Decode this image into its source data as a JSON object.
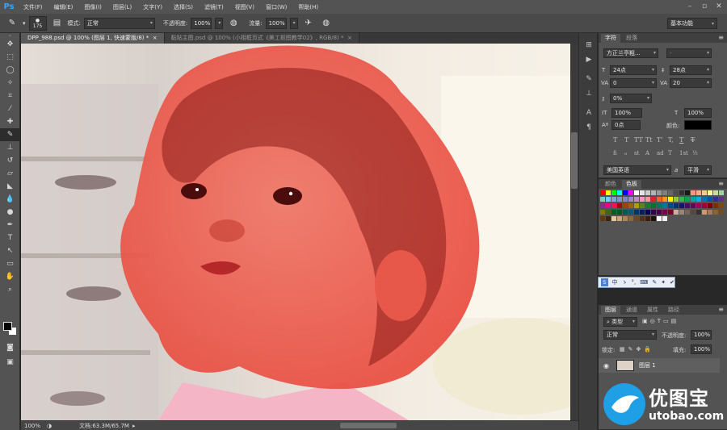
{
  "app": {
    "logo": "Ps"
  },
  "menu": [
    "文件(F)",
    "编辑(E)",
    "图像(I)",
    "图层(L)",
    "文字(Y)",
    "选择(S)",
    "滤镜(T)",
    "视图(V)",
    "窗口(W)",
    "帮助(H)"
  ],
  "options": {
    "brush_size": "175",
    "mode_label": "模式:",
    "mode_value": "正常",
    "opacity_label": "不透明度:",
    "opacity_value": "100%",
    "flow_label": "流量:",
    "flow_value": "100%",
    "workspace": "基本功能"
  },
  "tabs": [
    {
      "label": "DPP_988.psd @ 100% (图层 1, 快速蒙版/8) *",
      "active": true
    },
    {
      "label": "黏贴主图.psd @ 100% (小相框页式《美工抠图教学02》, RGB/8) *",
      "active": false
    }
  ],
  "status": {
    "zoom": "100%",
    "doc": "文档:63.3M/65.7M"
  },
  "character": {
    "tabs": [
      "字符",
      "段落"
    ],
    "font_family": "方正兰亭粗...",
    "font_style": "-",
    "font_size": "24点",
    "leading": "28点",
    "kerning": "0",
    "tracking": "20",
    "scale_pct": "0%",
    "vscale": "100%",
    "hscale": "100%",
    "baseline": "0点",
    "color_label": "颜色:",
    "styles": [
      "T",
      "T",
      "TT",
      "Tt",
      "T'",
      "T,",
      "T",
      "T"
    ],
    "opentype": [
      "fi",
      "ℴ",
      "st",
      "A",
      "ad",
      "T",
      "1st",
      "½"
    ],
    "language": "美国英语",
    "aa_label": "a",
    "antialias": "平滑"
  },
  "swatches": {
    "tabs": [
      "颜色",
      "色板"
    ],
    "rows": [
      [
        "#ff0000",
        "#ffff00",
        "#00ff00",
        "#00ffff",
        "#0000ff",
        "#ff00ff",
        "#ffffff",
        "#e6e6e6",
        "#cccccc",
        "#b3b3b3",
        "#999999",
        "#808080",
        "#666666",
        "#4d4d4d",
        "#333333",
        "#1a1a1a",
        "#f7977a",
        "#f9ad81",
        "#fdc68a",
        "#fff79a",
        "#c4df9b",
        "#a3d39c"
      ],
      [
        "#7accc8",
        "#6dcff6",
        "#7ea7d8",
        "#8493ca",
        "#8882be",
        "#a187be",
        "#bc8dbf",
        "#f49ac2",
        "#f6989d",
        "#ed1c24",
        "#f26522",
        "#f7941d",
        "#fff200",
        "#8dc63f",
        "#39b54a",
        "#00a651",
        "#00a99d",
        "#00aeef",
        "#0072bc",
        "#0054a6",
        "#2e3192",
        "#662d91"
      ],
      [
        "#92278f",
        "#ec008c",
        "#ed145b",
        "#9e0b0f",
        "#a0410d",
        "#a36209",
        "#aba000",
        "#598527",
        "#197b30",
        "#007236",
        "#00746b",
        "#0076a3",
        "#004b80",
        "#003471",
        "#1b1464",
        "#440e62",
        "#630460",
        "#9e005d",
        "#9e0039",
        "#790000",
        "#7b2e00",
        "#7d4900"
      ],
      [
        "#827b00",
        "#406618",
        "#005e20",
        "#005826",
        "#005952",
        "#005b7f",
        "#003663",
        "#002157",
        "#0d004c",
        "#32004b",
        "#4b0049",
        "#7b0046",
        "#7a0026",
        "#c7b299",
        "#998675",
        "#736357",
        "#534741",
        "#37302d",
        "#c69c6d",
        "#a67c52",
        "#8c6239",
        "#754c24"
      ],
      [
        "#603913",
        "#3c2415",
        "#e0c8a0",
        "#c8a878",
        "#a88858",
        "#886840",
        "#684828",
        "#503018",
        "#382010",
        "#201008",
        "#ffffff",
        "#f2f2f2"
      ]
    ]
  },
  "ime": {
    "items": [
      "中",
      "ゝ",
      "°,",
      "⌨",
      "✎",
      "✦",
      "✔"
    ]
  },
  "layers": {
    "tabs": [
      "图层",
      "通道",
      "属性",
      "路径"
    ],
    "kind_label": "类型",
    "blend": "正常",
    "opacity_label": "不透明度:",
    "opacity": "100%",
    "lock_label": "锁定:",
    "fill_label": "填充:",
    "fill": "100%",
    "layer_name": "图层 1"
  },
  "watermark": {
    "name": "优图宝",
    "url": "utobao.com"
  },
  "colors": {
    "accent": "#31a8ff",
    "overlay": "#e6281e",
    "panel": "#535353"
  }
}
